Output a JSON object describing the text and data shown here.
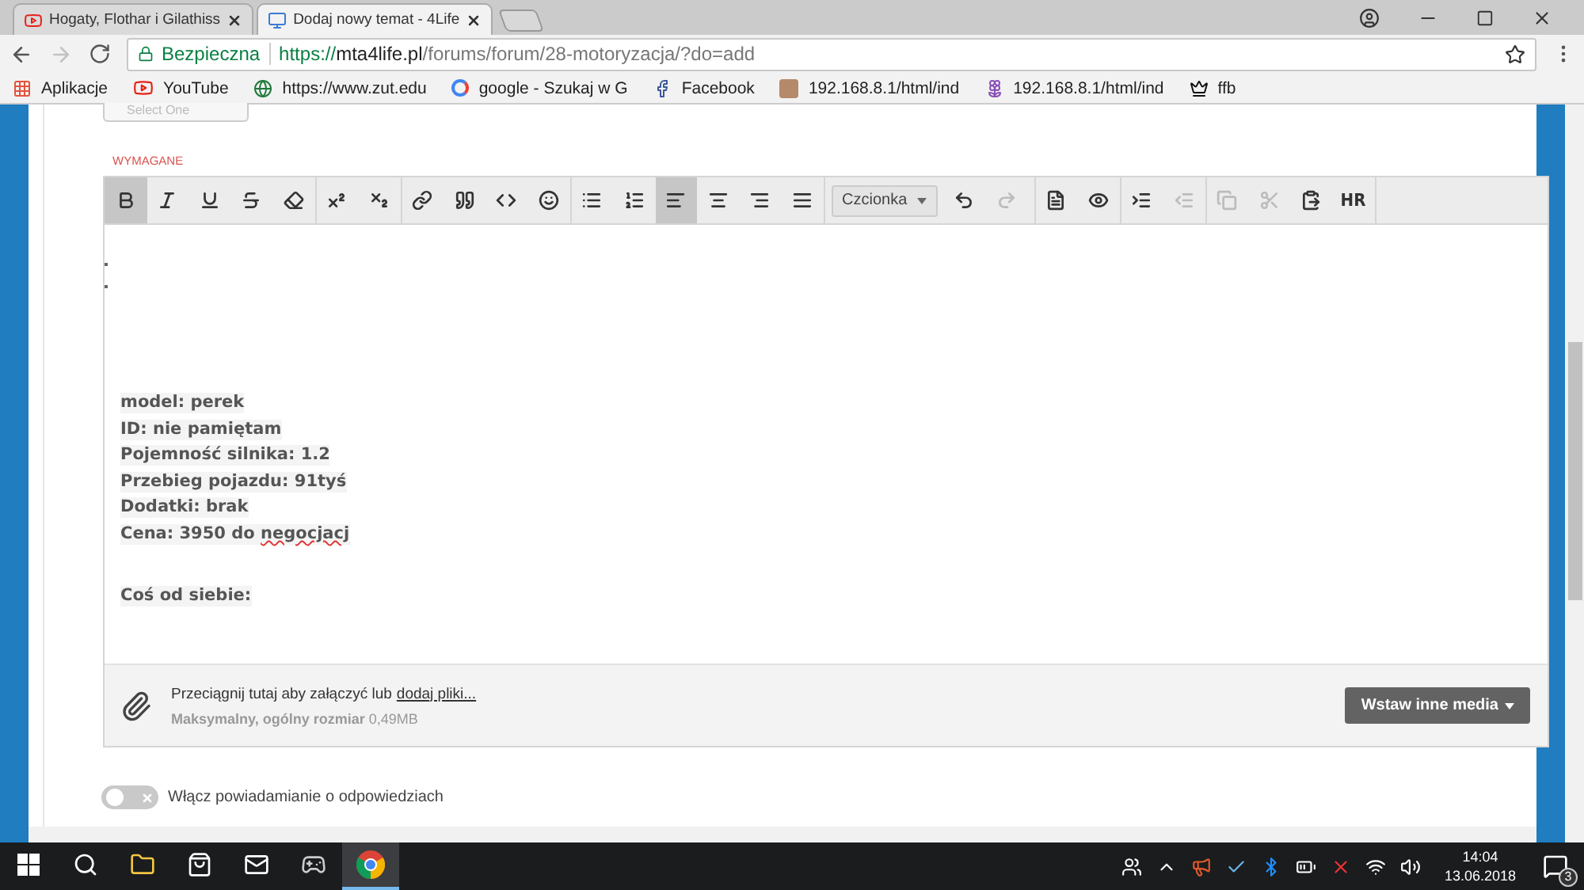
{
  "browser": {
    "tabs": [
      {
        "title": "Hogaty, Flothar i Gilathiss",
        "selected": false
      },
      {
        "title": "Dodaj nowy temat - 4Life",
        "selected": true
      }
    ],
    "forward_disabled": true,
    "address_bar": {
      "security_label": "Bezpieczna",
      "url_scheme": "https://",
      "url_host": "mta4life.pl",
      "url_path": "/forums/forum/28-motoryzacja/?do=add"
    },
    "bookmarks": [
      {
        "label": "Aplikacje"
      },
      {
        "label": "YouTube"
      },
      {
        "label": "https://www.zut.edu"
      },
      {
        "label": "google - Szukaj w G"
      },
      {
        "label": "Facebook"
      },
      {
        "label": "192.168.8.1/html/ind"
      },
      {
        "label": "192.168.8.1/html/ind"
      },
      {
        "label": "ffb"
      }
    ]
  },
  "form": {
    "select_placeholder": "Select One",
    "required_label": "WYMAGANE",
    "toolbar": {
      "groups": [
        [
          {
            "kind": "icon",
            "selected": true,
            "disabled": false
          },
          {
            "kind": "icon",
            "selected": false,
            "disabled": false
          },
          {
            "kind": "icon",
            "selected": false,
            "disabled": false
          },
          {
            "kind": "icon",
            "selected": false,
            "disabled": false
          },
          {
            "kind": "icon",
            "selected": false,
            "disabled": false
          }
        ],
        [
          {
            "kind": "icon",
            "selected": false,
            "disabled": false
          },
          {
            "kind": "icon",
            "selected": false,
            "disabled": false
          }
        ],
        [
          {
            "kind": "icon",
            "selected": false,
            "disabled": false
          },
          {
            "kind": "icon",
            "selected": false,
            "disabled": false
          },
          {
            "kind": "icon",
            "selected": false,
            "disabled": false
          },
          {
            "kind": "icon",
            "selected": false,
            "disabled": false
          }
        ],
        [
          {
            "kind": "icon",
            "selected": false,
            "disabled": false
          },
          {
            "kind": "icon",
            "selected": false,
            "disabled": false
          },
          {
            "kind": "icon",
            "selected": true,
            "disabled": false
          },
          {
            "kind": "icon",
            "selected": false,
            "disabled": false
          },
          {
            "kind": "icon",
            "selected": false,
            "disabled": false
          },
          {
            "kind": "icon",
            "selected": false,
            "disabled": false
          }
        ],
        [
          {
            "kind": "select",
            "label": "Czcionka"
          },
          {
            "kind": "icon",
            "selected": false,
            "disabled": false
          },
          {
            "kind": "icon",
            "selected": false,
            "disabled": true
          }
        ],
        [
          {
            "kind": "icon",
            "selected": false,
            "disabled": false
          },
          {
            "kind": "icon",
            "selected": false,
            "disabled": false
          }
        ],
        [
          {
            "kind": "icon",
            "selected": false,
            "disabled": false
          },
          {
            "kind": "icon",
            "selected": false,
            "disabled": true
          }
        ],
        [
          {
            "kind": "icon",
            "selected": false,
            "disabled": true
          },
          {
            "kind": "icon",
            "selected": false,
            "disabled": true
          },
          {
            "kind": "icon",
            "selected": false,
            "disabled": false
          },
          {
            "kind": "text",
            "label": "HR",
            "selected": false,
            "disabled": false
          }
        ]
      ]
    },
    "editor": {
      "lines": [
        {
          "text": "model: perek"
        },
        {
          "text": "ID: nie pamiętam"
        },
        {
          "text": "Pojemność silnika: 1.2"
        },
        {
          "text": "Przebieg pojazdu: 91tyś"
        },
        {
          "text": "Dodatki: brak"
        },
        {
          "text": "Cena: 3950 do ",
          "misspelled": "negocjacj"
        }
      ],
      "note": "Coś od siebie:"
    },
    "attachments": {
      "hint": "Przeciągnij tutaj aby załączyć lub",
      "link": "dodaj pliki...",
      "limit_label": "Maksymalny, ogólny rozmiar",
      "limit_value": "0,49MB",
      "media_button": "Wstaw inne media"
    },
    "notify_toggle": {
      "label": "Włącz powiadamianie o odpowiedziach",
      "on": false
    }
  },
  "taskbar": {
    "apps": [
      {
        "selected": false
      },
      {
        "selected": false
      },
      {
        "selected": false
      },
      {
        "selected": false
      },
      {
        "selected": false
      },
      {
        "selected": true
      }
    ],
    "time": "14:04",
    "date": "13.06.2018",
    "notifications": "3"
  }
}
